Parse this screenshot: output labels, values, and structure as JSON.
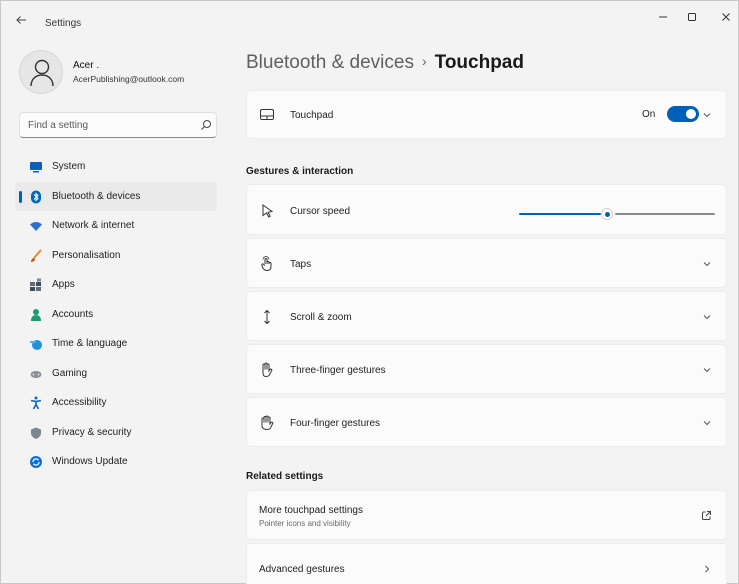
{
  "window": {
    "title": "Settings",
    "back_icon": "back-arrow-icon",
    "minimize_icon": "minimize-icon",
    "maximize_icon": "maximize-icon",
    "close_icon": "close-icon"
  },
  "profile": {
    "name": "Acer .",
    "email": "AcerPublishing@outlook.com"
  },
  "search": {
    "placeholder": "Find a setting"
  },
  "sidebar": {
    "items": [
      {
        "label": "System",
        "icon": "monitor-icon",
        "color": "#0a5fb8"
      },
      {
        "label": "Bluetooth & devices",
        "icon": "bluetooth-icon",
        "color": "#0067c0",
        "selected": true
      },
      {
        "label": "Network & internet",
        "icon": "wifi-icon",
        "color": "#2b6fd1"
      },
      {
        "label": "Personalisation",
        "icon": "brush-icon",
        "color": "#e08d2c"
      },
      {
        "label": "Apps",
        "icon": "apps-icon",
        "color": "#5d6b7a"
      },
      {
        "label": "Accounts",
        "icon": "person-icon",
        "color": "#1a9e6e"
      },
      {
        "label": "Time & language",
        "icon": "globe-clock-icon",
        "color": "#1f8fd6"
      },
      {
        "label": "Gaming",
        "icon": "gamepad-icon",
        "color": "#8a8f96"
      },
      {
        "label": "Accessibility",
        "icon": "accessibility-icon",
        "color": "#1566c0"
      },
      {
        "label": "Privacy & security",
        "icon": "shield-icon",
        "color": "#7d8590"
      },
      {
        "label": "Windows Update",
        "icon": "update-icon",
        "color": "#0a6fd6"
      }
    ]
  },
  "breadcrumb": {
    "parent": "Bluetooth & devices",
    "separator": "›",
    "current": "Touchpad"
  },
  "touchpad_card": {
    "label": "Touchpad",
    "toggle_text": "On",
    "toggle_on": true
  },
  "gestures_section": {
    "title": "Gestures & interaction",
    "cursor_speed_label": "Cursor speed",
    "cursor_speed_value": 0.45,
    "rows": [
      {
        "label": "Taps",
        "icon": "tap-icon"
      },
      {
        "label": "Scroll & zoom",
        "icon": "scroll-icon"
      },
      {
        "label": "Three-finger gestures",
        "icon": "three-finger-hand-icon"
      },
      {
        "label": "Four-finger gestures",
        "icon": "four-finger-hand-icon"
      }
    ]
  },
  "related_section": {
    "title": "Related settings",
    "more_title": "More touchpad settings",
    "more_subtitle": "Pointer icons and visibility",
    "advanced_title": "Advanced gestures"
  },
  "colors": {
    "accent": "#005fb8",
    "background": "#f3f3f3",
    "card": "#fbfbfb"
  }
}
